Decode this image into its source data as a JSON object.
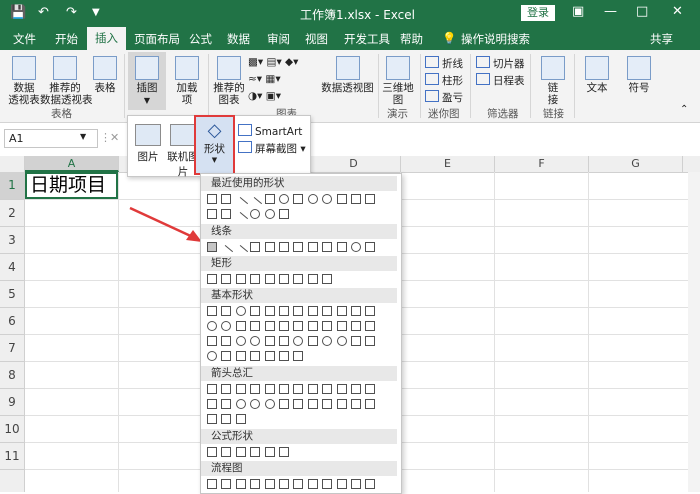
{
  "window": {
    "title": "工作簿1.xlsx  -  Excel",
    "login": "登录"
  },
  "tabs": [
    "文件",
    "开始",
    "插入",
    "页面布局",
    "公式",
    "数据",
    "审阅",
    "视图",
    "开发工具",
    "帮助",
    "操作说明搜索",
    "共享"
  ],
  "ribbon": {
    "pivot": "数据\n透视表",
    "rec_pivot": "推荐的\n数据透视表",
    "table": "表格",
    "group_tables": "表格",
    "illustrations": "插图",
    "addins": "加载\n项",
    "rec_charts": "推荐的\n图表",
    "pivot_chart": "数据透视图",
    "group_charts": "图表",
    "map3d": "三维地\n图",
    "group_tours": "演示",
    "spark_line": "折线",
    "spark_col": "柱形",
    "spark_winloss": "盈亏",
    "group_spark": "迷你图",
    "slicer": "切片器",
    "timeline": "日程表",
    "group_filters": "筛选器",
    "link": "链\n接",
    "group_links": "链接",
    "text": "文本",
    "symbol": "符号"
  },
  "formula": {
    "namebox": "A1"
  },
  "columns": [
    "A",
    "B",
    "C",
    "D",
    "E",
    "F",
    "G"
  ],
  "rows": [
    "1",
    "2",
    "3",
    "4",
    "5",
    "6",
    "7",
    "8",
    "9",
    "10",
    "11"
  ],
  "cells": {
    "A1": "日期项目"
  },
  "insert_menu": {
    "picture": "图片",
    "online_picture": "联机图片",
    "shapes": "形状",
    "smartart": "SmartArt",
    "screenshot": "屏幕截图"
  },
  "gallery": {
    "sections": [
      "最近使用的形状",
      "线条",
      "矩形",
      "基本形状",
      "箭头总汇",
      "公式形状",
      "流程图"
    ]
  },
  "colors": {
    "accent": "#217346",
    "highlight": "#e03a3a"
  }
}
